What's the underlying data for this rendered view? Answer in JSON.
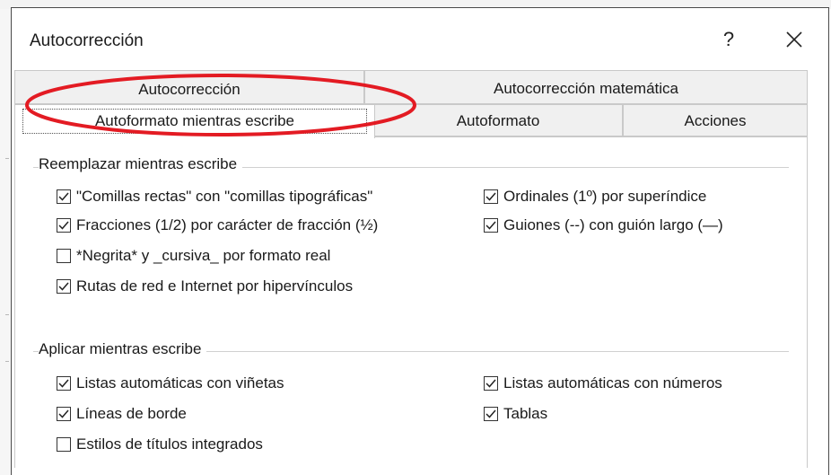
{
  "dialog": {
    "title": "Autocorrección",
    "help_label": "?",
    "close_icon": "close-icon"
  },
  "tabs": {
    "row1": [
      "Autocorrección",
      "Autocorrección matemática"
    ],
    "row2": [
      "Autoformato mientras escribe",
      "Autoformato",
      "Acciones"
    ],
    "active": "Autoformato mientras escribe"
  },
  "annotation": {
    "shape": "ellipse",
    "color": "#e31b23"
  },
  "sections": {
    "replace": {
      "label": "Reemplazar mientras escribe",
      "options": [
        {
          "label": "\"Comillas rectas\" con \"comillas tipográficas\"",
          "checked": true
        },
        {
          "label": "Ordinales (1º) por superíndice",
          "checked": true
        },
        {
          "label": "Fracciones (1/2) por carácter de fracción (½)",
          "checked": true
        },
        {
          "label": "Guiones (--) con guión largo (—)",
          "checked": true
        },
        {
          "label": "*Negrita* y _cursiva_ por formato real",
          "checked": false
        },
        {
          "label": "Rutas de red e Internet por hipervínculos",
          "checked": true
        }
      ]
    },
    "apply": {
      "label": "Aplicar mientras escribe",
      "options": [
        {
          "label": "Listas automáticas con viñetas",
          "checked": true
        },
        {
          "label": "Listas automáticas con números",
          "checked": true
        },
        {
          "label": "Líneas de borde",
          "checked": true
        },
        {
          "label": "Tablas",
          "checked": true
        },
        {
          "label": "Estilos de títulos integrados",
          "checked": false
        }
      ]
    }
  }
}
